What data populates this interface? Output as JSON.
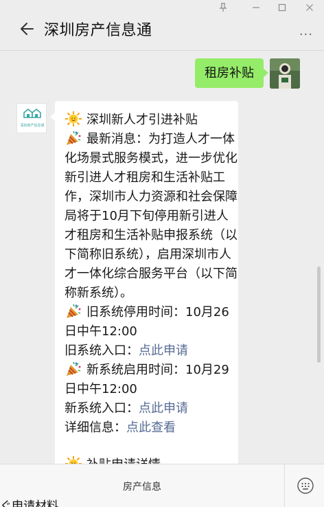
{
  "window": {
    "pin_icon": "pin-icon",
    "minimize_icon": "minimize-icon",
    "maximize_icon": "maximize-icon",
    "close_icon": "close-icon"
  },
  "header": {
    "title": "深圳房产信息通",
    "more": "···"
  },
  "sent_message": {
    "text": "租房补贴"
  },
  "bot": {
    "avatar_brand_text": "深圳房产信息通"
  },
  "reply": {
    "heading": "深圳新人才引进补贴",
    "paragraph": "最新消息：为打造人才一体化场景式服务模式，进一步优化新引进人才租房和生活补贴工作，深圳市人力资源和社会保障局将于10月下旬停用新引进人才租房和生活补贴申报系统（以下简称旧系统），启用深圳市人才一体化综合服务平台（以下简称新系统）。",
    "old_stop_label": "旧系统停用时间：10月26日中午12:00",
    "old_entry_label": "旧系统入口：",
    "old_entry_link": "点此申请",
    "new_start_label": "新系统启用时间：10月29日中午12:00",
    "new_entry_label": "新系统入口：",
    "new_entry_link": "点此申请",
    "detail_label": "详细信息：",
    "detail_link": "点此查看",
    "section2": "补贴申请详情"
  },
  "bottom": {
    "menu_label": "房产信息",
    "keyboard_icon": "keyboard-icon",
    "overflow_text": "ぐ申请材料"
  },
  "colors": {
    "background": "#ededed",
    "my_bubble": "#95ec69",
    "link": "#576b95",
    "brand": "#3aa7a6"
  }
}
